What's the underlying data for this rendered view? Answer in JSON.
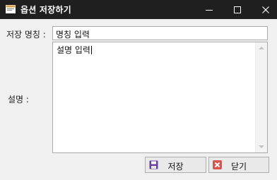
{
  "window": {
    "title": "옵션 저장하기"
  },
  "form": {
    "name_label": "저장 명칭 :",
    "name_value": "명칭 입력",
    "description_label": "설명 :",
    "description_value": "설명 입력"
  },
  "buttons": {
    "save_label": "저장",
    "close_label": "닫기"
  },
  "colors": {
    "titlebar": "#1f1f1f",
    "window_bg": "#f0f0f0",
    "save_icon": "#6b3fa0",
    "close_icon": "#d9534f"
  },
  "icons": {
    "app": "folder-window-icon",
    "save": "floppy-disk-icon",
    "close": "close-x-icon"
  }
}
